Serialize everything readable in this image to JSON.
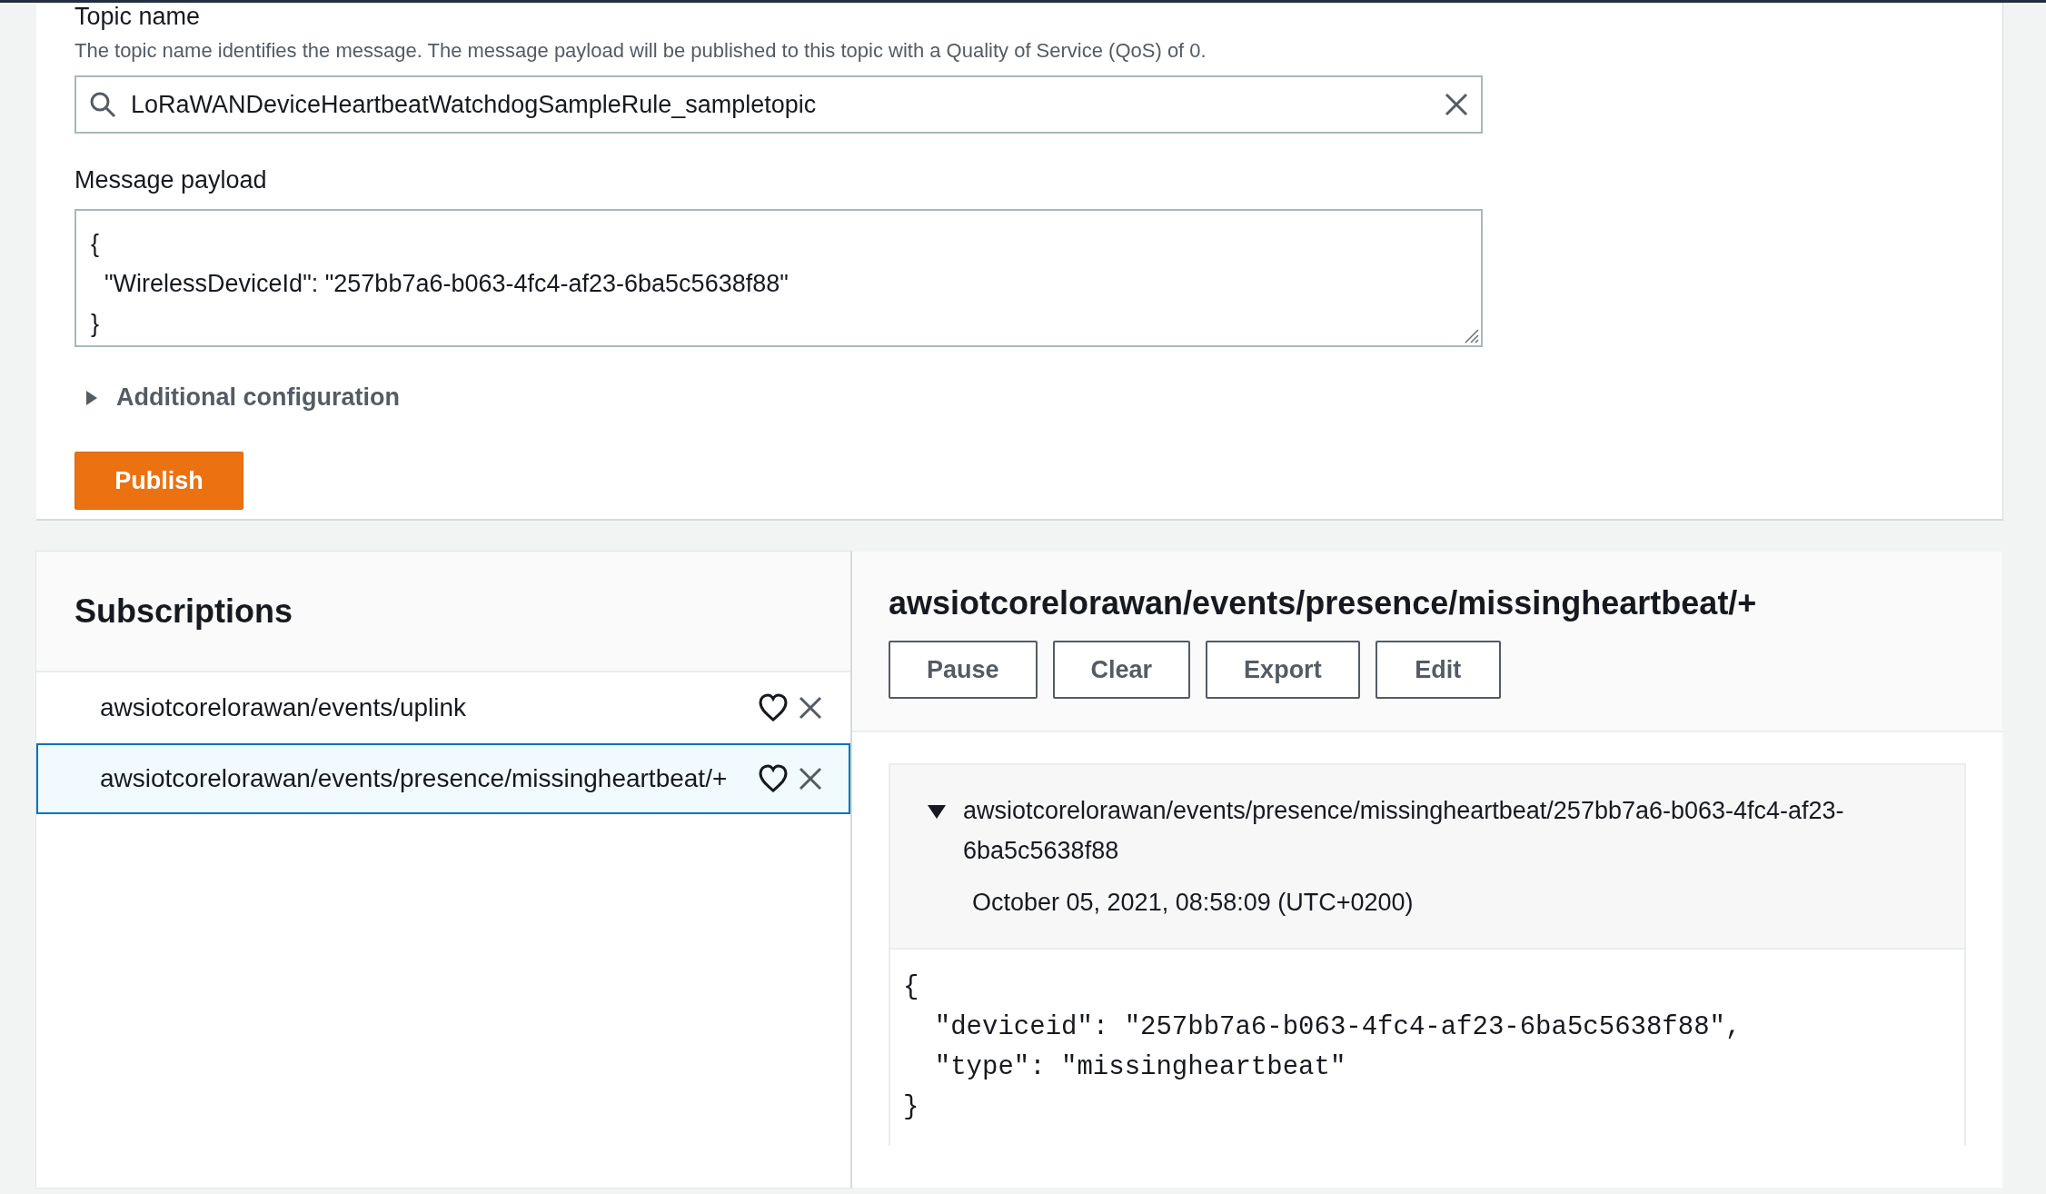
{
  "publish_form": {
    "topic_label": "Topic name",
    "topic_hint": "The topic name identifies the message. The message payload will be published to this topic with a Quality of Service (QoS) of 0.",
    "topic_value": "LoRaWANDeviceHeartbeatWatchdogSampleRule_sampletopic",
    "payload_label": "Message payload",
    "payload": "{\n  \"WirelessDeviceId\": \"257bb7a6-b063-4fc4-af23-6ba5c5638f88\"\n}",
    "additional_config": {
      "label": "Additional configuration",
      "expanded": false
    },
    "publish_button": "Publish"
  },
  "subscriptions": {
    "title": "Subscriptions",
    "items": [
      {
        "topic": "awsiotcorelorawan/events/uplink",
        "selected": false
      },
      {
        "topic": "awsiotcorelorawan/events/presence/missingheartbeat/+",
        "selected": true
      }
    ]
  },
  "viewer": {
    "title": "awsiotcorelorawan/events/presence/missingheartbeat/+",
    "buttons": [
      "Pause",
      "Clear",
      "Export",
      "Edit"
    ],
    "messages": [
      {
        "topic": "awsiotcorelorawan/events/presence/missingheartbeat/257bb7a6-b063-4fc4-af23-6ba5c5638f88",
        "time": "October 05, 2021, 08:58:09 (UTC+0200)",
        "expanded": true,
        "body": "{\n  \"deviceid\": \"257bb7a6-b063-4fc4-af23-6ba5c5638f88\",\n  \"type\": \"missingheartbeat\"\n}"
      }
    ]
  }
}
